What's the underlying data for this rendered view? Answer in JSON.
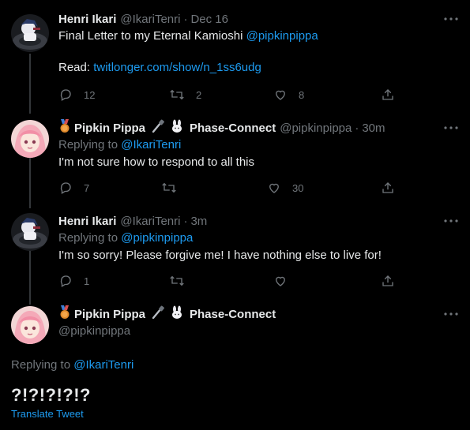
{
  "tweets": [
    {
      "name": "Henri Ikari",
      "handle": "@IkariTenri",
      "time": "Dec 16",
      "line1_text": "Final Letter to my Eternal Kamioshi ",
      "line1_mention": "@pipkinpippa",
      "line2_label": "Read: ",
      "line2_link": "twitlonger.com/show/n_1ss6udg",
      "replies": "12",
      "retweets": "2",
      "likes": "8"
    },
    {
      "name": "Pipkin Pippa",
      "org": "Phase-Connect",
      "handle": "@pipkinpippa",
      "time": "30m",
      "replying_label": "Replying to ",
      "replying_to": "@IkariTenri",
      "text": "I'm not sure how to respond to all this",
      "replies": "7",
      "retweets": "",
      "likes": "30"
    },
    {
      "name": "Henri Ikari",
      "handle": "@IkariTenri",
      "time": "3m",
      "replying_label": "Replying to ",
      "replying_to": "@pipkinpippa",
      "text": "I'm so sorry! Please forgive me! I have nothing else to live for!",
      "replies": "1",
      "retweets": "",
      "likes": ""
    }
  ],
  "focus": {
    "name": "Pipkin Pippa",
    "org": "Phase-Connect",
    "handle": "@pipkinpippa",
    "replying_label": "Replying to ",
    "replying_to": "@IkariTenri",
    "text": "?!?!?!?!?",
    "translate": "Translate Tweet"
  },
  "separator": "·",
  "icons": [
    "more-icon",
    "reply-icon",
    "retweet-icon",
    "like-icon",
    "share-icon",
    "medal-badge-icon",
    "cable-emoji-icon",
    "bunny-emoji-icon"
  ],
  "colors": {
    "background": "#000000",
    "text": "#e7e9ea",
    "muted": "#71767b",
    "link": "#1d9bf0"
  }
}
